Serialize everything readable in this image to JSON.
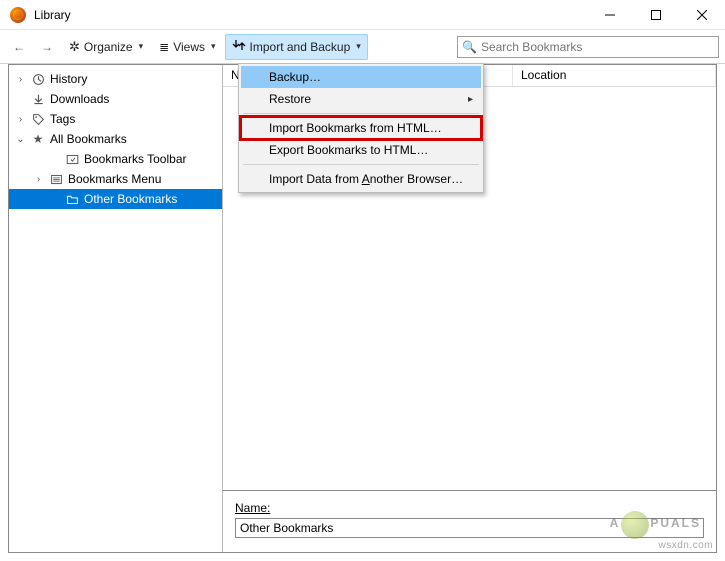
{
  "window": {
    "title": "Library"
  },
  "toolbar": {
    "organize": "Organize",
    "views": "Views",
    "import_backup": "Import and Backup",
    "search_placeholder": "Search Bookmarks"
  },
  "menu": {
    "backup": "Backup…",
    "restore": "Restore",
    "import_html": "Import Bookmarks from HTML…",
    "export_html": "Export Bookmarks to HTML…",
    "import_another_pre": "Import Data from ",
    "import_another_u": "A",
    "import_another_post": "nother Browser…"
  },
  "tree": {
    "history": "History",
    "downloads": "Downloads",
    "tags": "Tags",
    "all_bookmarks": "All Bookmarks",
    "toolbar": "Bookmarks Toolbar",
    "menu": "Bookmarks Menu",
    "other": "Other Bookmarks"
  },
  "columns": {
    "name": "Name",
    "location": "Location"
  },
  "detail": {
    "label": "Name:",
    "value": "Other Bookmarks"
  },
  "watermark": {
    "pre": "A",
    "post": "PUALS",
    "site": "wsxdn.com"
  }
}
